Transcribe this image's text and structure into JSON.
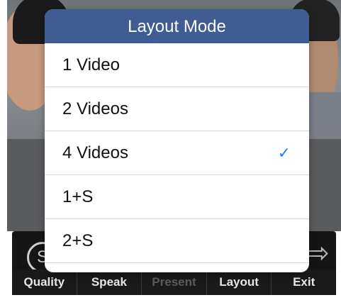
{
  "popover": {
    "title": "Layout Mode",
    "items": [
      {
        "label": "1 Video",
        "selected": false
      },
      {
        "label": "2 Videos",
        "selected": false
      },
      {
        "label": "4 Videos",
        "selected": true
      },
      {
        "label": "1+S",
        "selected": false
      },
      {
        "label": "2+S",
        "selected": false
      }
    ],
    "check_icon": "checkmark-icon",
    "check_glyph": "✓",
    "check_color": "#2f7cf6",
    "header_color": "#3f5d93"
  },
  "toolbar": {
    "buttons": [
      {
        "label": "Quality",
        "enabled": true
      },
      {
        "label": "Speak",
        "enabled": true
      },
      {
        "label": "Present",
        "enabled": false
      },
      {
        "label": "Layout",
        "enabled": true
      },
      {
        "label": "Exit",
        "enabled": true
      }
    ],
    "quality_icon": "quality-s-icon",
    "quality_glyph": "S",
    "exit_icon": "exit-arrow-icon",
    "exit_glyph": "⇨"
  }
}
